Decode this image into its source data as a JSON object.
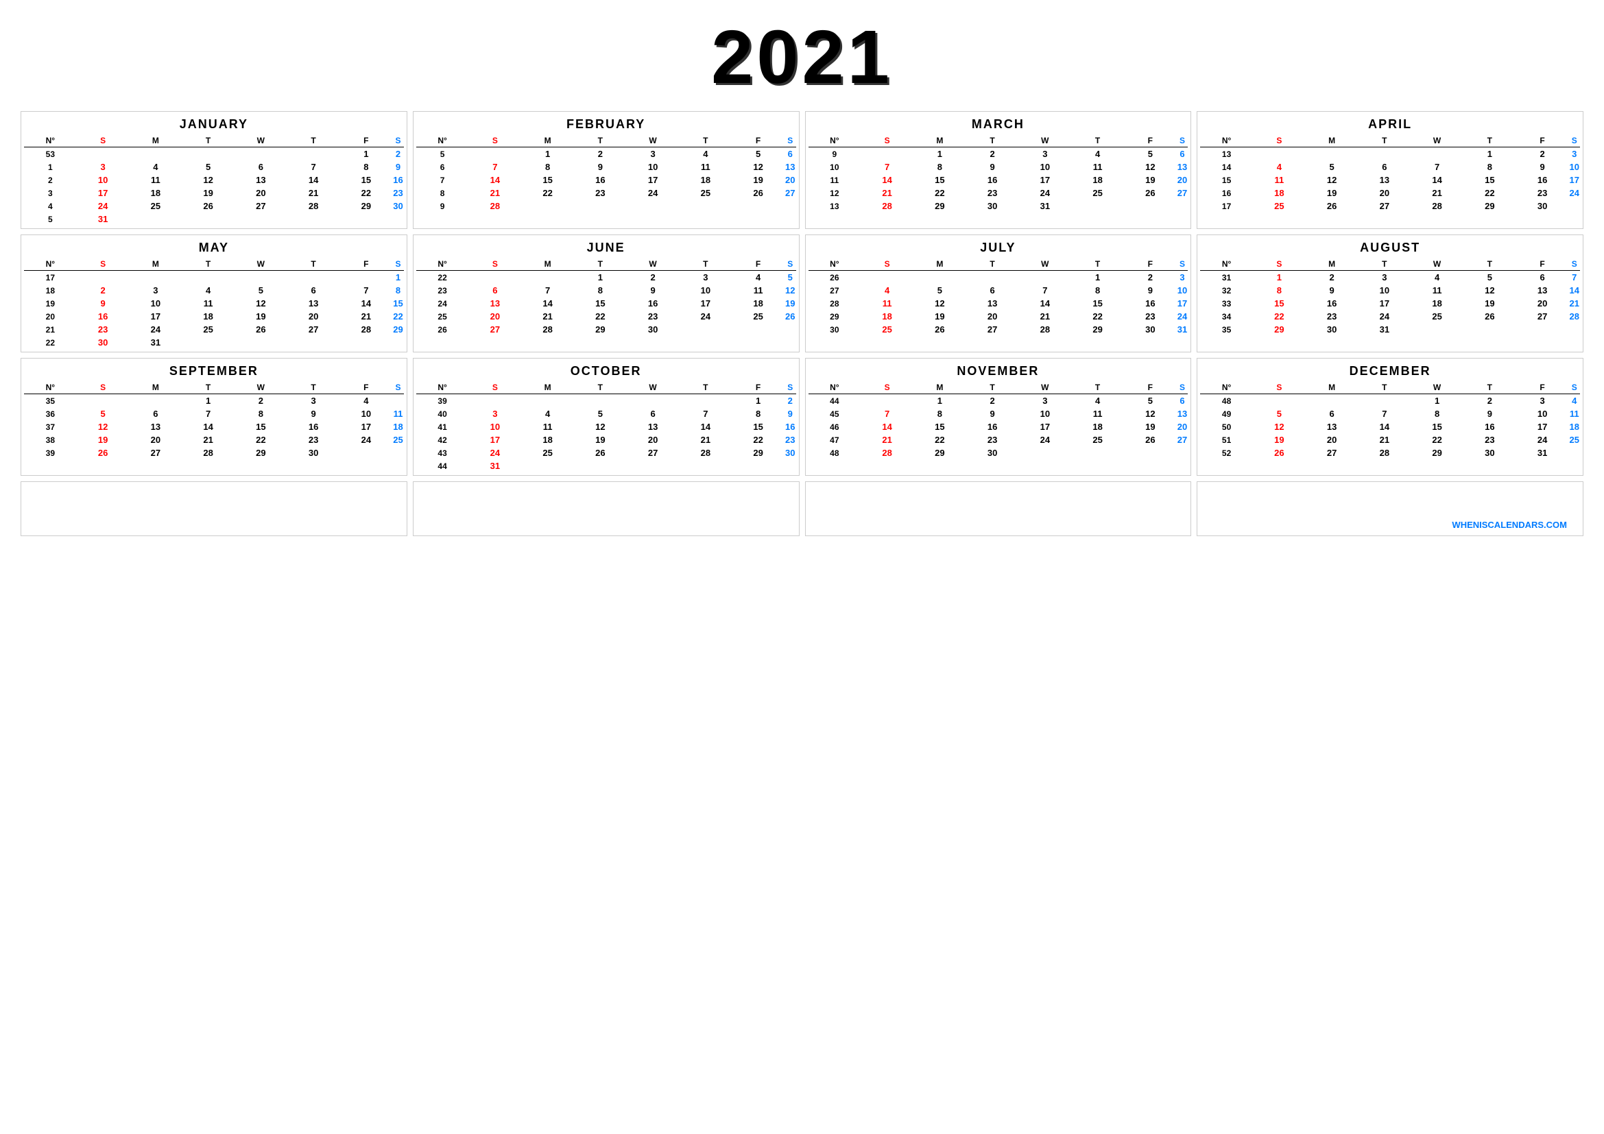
{
  "year": "2021",
  "months": [
    {
      "name": "JANUARY",
      "weeks": [
        {
          "wk": "53",
          "sun": "",
          "mon": "",
          "tue": "",
          "wed": "",
          "thu": "",
          "fri": "1",
          "sat": "2"
        },
        {
          "wk": "1",
          "sun": "3",
          "mon": "4",
          "tue": "5",
          "wed": "6",
          "thu": "7",
          "fri": "8",
          "sat": "9"
        },
        {
          "wk": "2",
          "sun": "10",
          "mon": "11",
          "tue": "12",
          "wed": "13",
          "thu": "14",
          "fri": "15",
          "sat": "16"
        },
        {
          "wk": "3",
          "sun": "17",
          "mon": "18",
          "tue": "19",
          "wed": "20",
          "thu": "21",
          "fri": "22",
          "sat": "23"
        },
        {
          "wk": "4",
          "sun": "24",
          "mon": "25",
          "tue": "26",
          "wed": "27",
          "thu": "28",
          "fri": "29",
          "sat": "30"
        },
        {
          "wk": "5",
          "sun": "31",
          "mon": "",
          "tue": "",
          "wed": "",
          "thu": "",
          "fri": "",
          "sat": ""
        }
      ]
    },
    {
      "name": "FEBRUARY",
      "weeks": [
        {
          "wk": "5",
          "sun": "",
          "mon": "1",
          "tue": "2",
          "wed": "3",
          "thu": "4",
          "fri": "5",
          "sat": "6"
        },
        {
          "wk": "6",
          "sun": "7",
          "mon": "8",
          "tue": "9",
          "wed": "10",
          "thu": "11",
          "fri": "12",
          "sat": "13"
        },
        {
          "wk": "7",
          "sun": "14",
          "mon": "15",
          "tue": "16",
          "wed": "17",
          "thu": "18",
          "fri": "19",
          "sat": "20"
        },
        {
          "wk": "8",
          "sun": "21",
          "mon": "22",
          "tue": "23",
          "wed": "24",
          "thu": "25",
          "fri": "26",
          "sat": "27"
        },
        {
          "wk": "9",
          "sun": "28",
          "mon": "",
          "tue": "",
          "wed": "",
          "thu": "",
          "fri": "",
          "sat": ""
        },
        {
          "wk": "",
          "sun": "",
          "mon": "",
          "tue": "",
          "wed": "",
          "thu": "",
          "fri": "",
          "sat": ""
        }
      ]
    },
    {
      "name": "MARCH",
      "weeks": [
        {
          "wk": "9",
          "sun": "",
          "mon": "1",
          "tue": "2",
          "wed": "3",
          "thu": "4",
          "fri": "5",
          "sat": "6"
        },
        {
          "wk": "10",
          "sun": "7",
          "mon": "8",
          "tue": "9",
          "wed": "10",
          "thu": "11",
          "fri": "12",
          "sat": "13"
        },
        {
          "wk": "11",
          "sun": "14",
          "mon": "15",
          "tue": "16",
          "wed": "17",
          "thu": "18",
          "fri": "19",
          "sat": "20"
        },
        {
          "wk": "12",
          "sun": "21",
          "mon": "22",
          "tue": "23",
          "wed": "24",
          "thu": "25",
          "fri": "26",
          "sat": "27"
        },
        {
          "wk": "13",
          "sun": "28",
          "mon": "29",
          "tue": "30",
          "wed": "31",
          "thu": "",
          "fri": "",
          "sat": ""
        },
        {
          "wk": "",
          "sun": "",
          "mon": "",
          "tue": "",
          "wed": "",
          "thu": "",
          "fri": "",
          "sat": ""
        }
      ]
    },
    {
      "name": "APRIL",
      "weeks": [
        {
          "wk": "13",
          "sun": "",
          "mon": "",
          "tue": "",
          "wed": "",
          "thu": "1",
          "fri": "2",
          "sat": "3"
        },
        {
          "wk": "14",
          "sun": "4",
          "mon": "5",
          "tue": "6",
          "wed": "7",
          "thu": "8",
          "fri": "9",
          "sat": "10"
        },
        {
          "wk": "15",
          "sun": "11",
          "mon": "12",
          "tue": "13",
          "wed": "14",
          "thu": "15",
          "fri": "16",
          "sat": "17"
        },
        {
          "wk": "16",
          "sun": "18",
          "mon": "19",
          "tue": "20",
          "wed": "21",
          "thu": "22",
          "fri": "23",
          "sat": "24"
        },
        {
          "wk": "17",
          "sun": "25",
          "mon": "26",
          "tue": "27",
          "wed": "28",
          "thu": "29",
          "fri": "30",
          "sat": ""
        },
        {
          "wk": "",
          "sun": "",
          "mon": "",
          "tue": "",
          "wed": "",
          "thu": "",
          "fri": "",
          "sat": ""
        }
      ]
    },
    {
      "name": "MAY",
      "weeks": [
        {
          "wk": "17",
          "sun": "",
          "mon": "",
          "tue": "",
          "wed": "",
          "thu": "",
          "fri": "",
          "sat": "1"
        },
        {
          "wk": "18",
          "sun": "2",
          "mon": "3",
          "tue": "4",
          "wed": "5",
          "thu": "6",
          "fri": "7",
          "sat": "8"
        },
        {
          "wk": "19",
          "sun": "9",
          "mon": "10",
          "tue": "11",
          "wed": "12",
          "thu": "13",
          "fri": "14",
          "sat": "15"
        },
        {
          "wk": "20",
          "sun": "16",
          "mon": "17",
          "tue": "18",
          "wed": "19",
          "thu": "20",
          "fri": "21",
          "sat": "22"
        },
        {
          "wk": "21",
          "sun": "23",
          "mon": "24",
          "tue": "25",
          "wed": "26",
          "thu": "27",
          "fri": "28",
          "sat": "29"
        },
        {
          "wk": "22",
          "sun": "30",
          "mon": "31",
          "tue": "",
          "wed": "",
          "thu": "",
          "fri": "",
          "sat": ""
        }
      ]
    },
    {
      "name": "JUNE",
      "weeks": [
        {
          "wk": "22",
          "sun": "",
          "mon": "",
          "tue": "1",
          "wed": "2",
          "thu": "3",
          "fri": "4",
          "sat": "5"
        },
        {
          "wk": "23",
          "sun": "6",
          "mon": "7",
          "tue": "8",
          "wed": "9",
          "thu": "10",
          "fri": "11",
          "sat": "12"
        },
        {
          "wk": "24",
          "sun": "13",
          "mon": "14",
          "tue": "15",
          "wed": "16",
          "thu": "17",
          "fri": "18",
          "sat": "19"
        },
        {
          "wk": "25",
          "sun": "20",
          "mon": "21",
          "tue": "22",
          "wed": "23",
          "thu": "24",
          "fri": "25",
          "sat": "26"
        },
        {
          "wk": "26",
          "sun": "27",
          "mon": "28",
          "tue": "29",
          "wed": "30",
          "thu": "",
          "fri": "",
          "sat": ""
        },
        {
          "wk": "",
          "sun": "",
          "mon": "",
          "tue": "",
          "wed": "",
          "thu": "",
          "fri": "",
          "sat": ""
        }
      ]
    },
    {
      "name": "JULY",
      "weeks": [
        {
          "wk": "26",
          "sun": "",
          "mon": "",
          "tue": "",
          "wed": "",
          "thu": "1",
          "fri": "2",
          "sat": "3"
        },
        {
          "wk": "27",
          "sun": "4",
          "mon": "5",
          "tue": "6",
          "wed": "7",
          "thu": "8",
          "fri": "9",
          "sat": "10"
        },
        {
          "wk": "28",
          "sun": "11",
          "mon": "12",
          "tue": "13",
          "wed": "14",
          "thu": "15",
          "fri": "16",
          "sat": "17"
        },
        {
          "wk": "29",
          "sun": "18",
          "mon": "19",
          "tue": "20",
          "wed": "21",
          "thu": "22",
          "fri": "23",
          "sat": "24"
        },
        {
          "wk": "30",
          "sun": "25",
          "mon": "26",
          "tue": "27",
          "wed": "28",
          "thu": "29",
          "fri": "30",
          "sat": "31"
        },
        {
          "wk": "",
          "sun": "",
          "mon": "",
          "tue": "",
          "wed": "",
          "thu": "",
          "fri": "",
          "sat": ""
        }
      ]
    },
    {
      "name": "AUGUST",
      "weeks": [
        {
          "wk": "31",
          "sun": "1",
          "mon": "2",
          "tue": "3",
          "wed": "4",
          "thu": "5",
          "fri": "6",
          "sat": "7"
        },
        {
          "wk": "32",
          "sun": "8",
          "mon": "9",
          "tue": "10",
          "wed": "11",
          "thu": "12",
          "fri": "13",
          "sat": "14"
        },
        {
          "wk": "33",
          "sun": "15",
          "mon": "16",
          "tue": "17",
          "wed": "18",
          "thu": "19",
          "fri": "20",
          "sat": "21"
        },
        {
          "wk": "34",
          "sun": "22",
          "mon": "23",
          "tue": "24",
          "wed": "25",
          "thu": "26",
          "fri": "27",
          "sat": "28"
        },
        {
          "wk": "35",
          "sun": "29",
          "mon": "30",
          "tue": "31",
          "wed": "",
          "thu": "",
          "fri": "",
          "sat": ""
        },
        {
          "wk": "",
          "sun": "",
          "mon": "",
          "tue": "",
          "wed": "",
          "thu": "",
          "fri": "",
          "sat": ""
        }
      ]
    },
    {
      "name": "SEPTEMBER",
      "weeks": [
        {
          "wk": "35",
          "sun": "",
          "mon": "",
          "tue": "1",
          "wed": "2",
          "thu": "3",
          "fri": "4",
          "sat": ""
        },
        {
          "wk": "36",
          "sun": "5",
          "mon": "6",
          "tue": "7",
          "wed": "8",
          "thu": "9",
          "fri": "10",
          "sat": "11"
        },
        {
          "wk": "37",
          "sun": "12",
          "mon": "13",
          "tue": "14",
          "wed": "15",
          "thu": "16",
          "fri": "17",
          "sat": "18"
        },
        {
          "wk": "38",
          "sun": "19",
          "mon": "20",
          "tue": "21",
          "wed": "22",
          "thu": "23",
          "fri": "24",
          "sat": "25"
        },
        {
          "wk": "39",
          "sun": "26",
          "mon": "27",
          "tue": "28",
          "wed": "29",
          "thu": "30",
          "fri": "",
          "sat": ""
        },
        {
          "wk": "",
          "sun": "",
          "mon": "",
          "tue": "",
          "wed": "",
          "thu": "",
          "fri": "",
          "sat": ""
        }
      ]
    },
    {
      "name": "OCTOBER",
      "weeks": [
        {
          "wk": "39",
          "sun": "",
          "mon": "",
          "tue": "",
          "wed": "",
          "thu": "",
          "fri": "1",
          "sat": "2"
        },
        {
          "wk": "40",
          "sun": "3",
          "mon": "4",
          "tue": "5",
          "wed": "6",
          "thu": "7",
          "fri": "8",
          "sat": "9"
        },
        {
          "wk": "41",
          "sun": "10",
          "mon": "11",
          "tue": "12",
          "wed": "13",
          "thu": "14",
          "fri": "15",
          "sat": "16"
        },
        {
          "wk": "42",
          "sun": "17",
          "mon": "18",
          "tue": "19",
          "wed": "20",
          "thu": "21",
          "fri": "22",
          "sat": "23"
        },
        {
          "wk": "43",
          "sun": "24",
          "mon": "25",
          "tue": "26",
          "wed": "27",
          "thu": "28",
          "fri": "29",
          "sat": "30"
        },
        {
          "wk": "44",
          "sun": "31",
          "mon": "",
          "tue": "",
          "wed": "",
          "thu": "",
          "fri": "",
          "sat": ""
        }
      ]
    },
    {
      "name": "NOVEMBER",
      "weeks": [
        {
          "wk": "44",
          "sun": "",
          "mon": "1",
          "tue": "2",
          "wed": "3",
          "thu": "4",
          "fri": "5",
          "sat": "6"
        },
        {
          "wk": "45",
          "sun": "7",
          "mon": "8",
          "tue": "9",
          "wed": "10",
          "thu": "11",
          "fri": "12",
          "sat": "13"
        },
        {
          "wk": "46",
          "sun": "14",
          "mon": "15",
          "tue": "16",
          "wed": "17",
          "thu": "18",
          "fri": "19",
          "sat": "20"
        },
        {
          "wk": "47",
          "sun": "21",
          "mon": "22",
          "tue": "23",
          "wed": "24",
          "thu": "25",
          "fri": "26",
          "sat": "27"
        },
        {
          "wk": "48",
          "sun": "28",
          "mon": "29",
          "tue": "30",
          "wed": "",
          "thu": "",
          "fri": "",
          "sat": ""
        },
        {
          "wk": "",
          "sun": "",
          "mon": "",
          "tue": "",
          "wed": "",
          "thu": "",
          "fri": "",
          "sat": ""
        }
      ]
    },
    {
      "name": "DECEMBER",
      "weeks": [
        {
          "wk": "48",
          "sun": "",
          "mon": "",
          "tue": "",
          "wed": "1",
          "thu": "2",
          "fri": "3",
          "sat": "4"
        },
        {
          "wk": "49",
          "sun": "5",
          "mon": "6",
          "tue": "7",
          "wed": "8",
          "thu": "9",
          "fri": "10",
          "sat": "11"
        },
        {
          "wk": "50",
          "sun": "12",
          "mon": "13",
          "tue": "14",
          "wed": "15",
          "thu": "16",
          "fri": "17",
          "sat": "18"
        },
        {
          "wk": "51",
          "sun": "19",
          "mon": "20",
          "tue": "21",
          "wed": "22",
          "thu": "23",
          "fri": "24",
          "sat": "25"
        },
        {
          "wk": "52",
          "sun": "26",
          "mon": "27",
          "tue": "28",
          "wed": "29",
          "thu": "30",
          "fri": "31",
          "sat": ""
        },
        {
          "wk": "",
          "sun": "",
          "mon": "",
          "tue": "",
          "wed": "",
          "thu": "",
          "fri": "",
          "sat": ""
        }
      ]
    }
  ],
  "headers": {
    "wk": "N°",
    "sun": "S",
    "mon": "M",
    "tue": "T",
    "wed": "W",
    "thu": "T",
    "fri": "F",
    "sat": "S"
  },
  "watermark": "WHENISCALENDARS.COM"
}
